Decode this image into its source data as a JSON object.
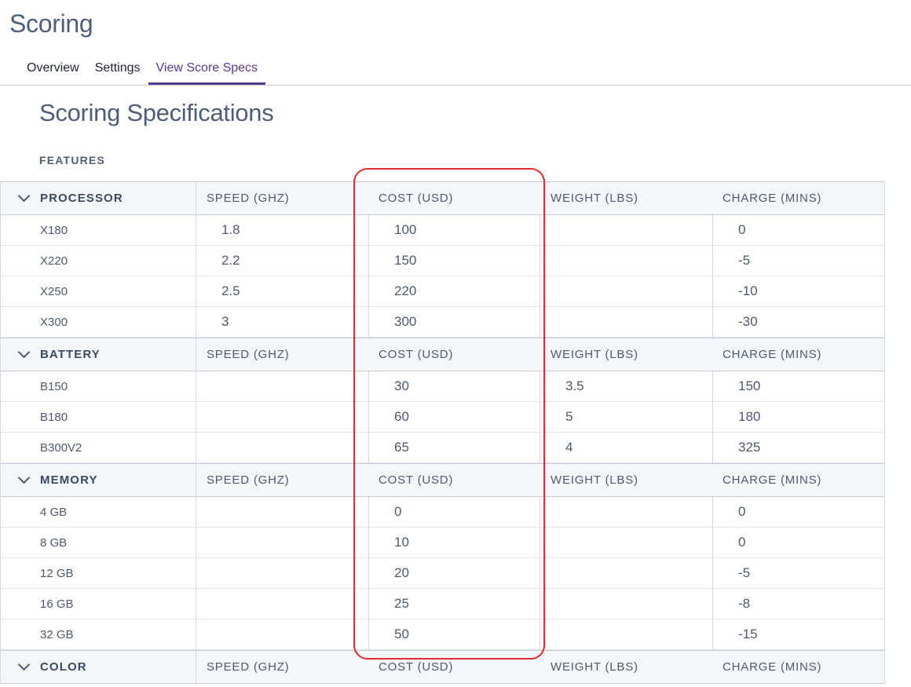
{
  "app": {
    "title": "Scoring"
  },
  "tabs": [
    {
      "label": "Overview",
      "active": false
    },
    {
      "label": "Settings",
      "active": false
    },
    {
      "label": "View Score Specs",
      "active": true
    }
  ],
  "page": {
    "title": "Scoring Specifications",
    "section_label": "FEATURES"
  },
  "columns": [
    "SPEED (GHZ)",
    "COST (USD)",
    "WEIGHT (LBS)",
    "CHARGE (MINS)"
  ],
  "groups": [
    {
      "name": "PROCESSOR",
      "items": [
        {
          "name": "X180",
          "speed": "1.8",
          "cost": "100",
          "weight": "",
          "charge": "0"
        },
        {
          "name": "X220",
          "speed": "2.2",
          "cost": "150",
          "weight": "",
          "charge": "-5"
        },
        {
          "name": "X250",
          "speed": "2.5",
          "cost": "220",
          "weight": "",
          "charge": "-10"
        },
        {
          "name": "X300",
          "speed": "3",
          "cost": "300",
          "weight": "",
          "charge": "-30"
        }
      ]
    },
    {
      "name": "BATTERY",
      "items": [
        {
          "name": "B150",
          "speed": "",
          "cost": "30",
          "weight": "3.5",
          "charge": "150"
        },
        {
          "name": "B180",
          "speed": "",
          "cost": "60",
          "weight": "5",
          "charge": "180"
        },
        {
          "name": "B300V2",
          "speed": "",
          "cost": "65",
          "weight": "4",
          "charge": "325"
        }
      ]
    },
    {
      "name": "MEMORY",
      "items": [
        {
          "name": "4 GB",
          "speed": "",
          "cost": "0",
          "weight": "",
          "charge": "0"
        },
        {
          "name": "8 GB",
          "speed": "",
          "cost": "10",
          "weight": "",
          "charge": "0"
        },
        {
          "name": "12 GB",
          "speed": "",
          "cost": "20",
          "weight": "",
          "charge": "-5"
        },
        {
          "name": "16 GB",
          "speed": "",
          "cost": "25",
          "weight": "",
          "charge": "-8"
        },
        {
          "name": "32 GB",
          "speed": "",
          "cost": "50",
          "weight": "",
          "charge": "-15"
        }
      ]
    },
    {
      "name": "COLOR",
      "items": []
    }
  ],
  "colors": {
    "accent": "#5a3b8c",
    "highlight": "#dd2c2c",
    "header_bg": "#f4f7f9"
  }
}
